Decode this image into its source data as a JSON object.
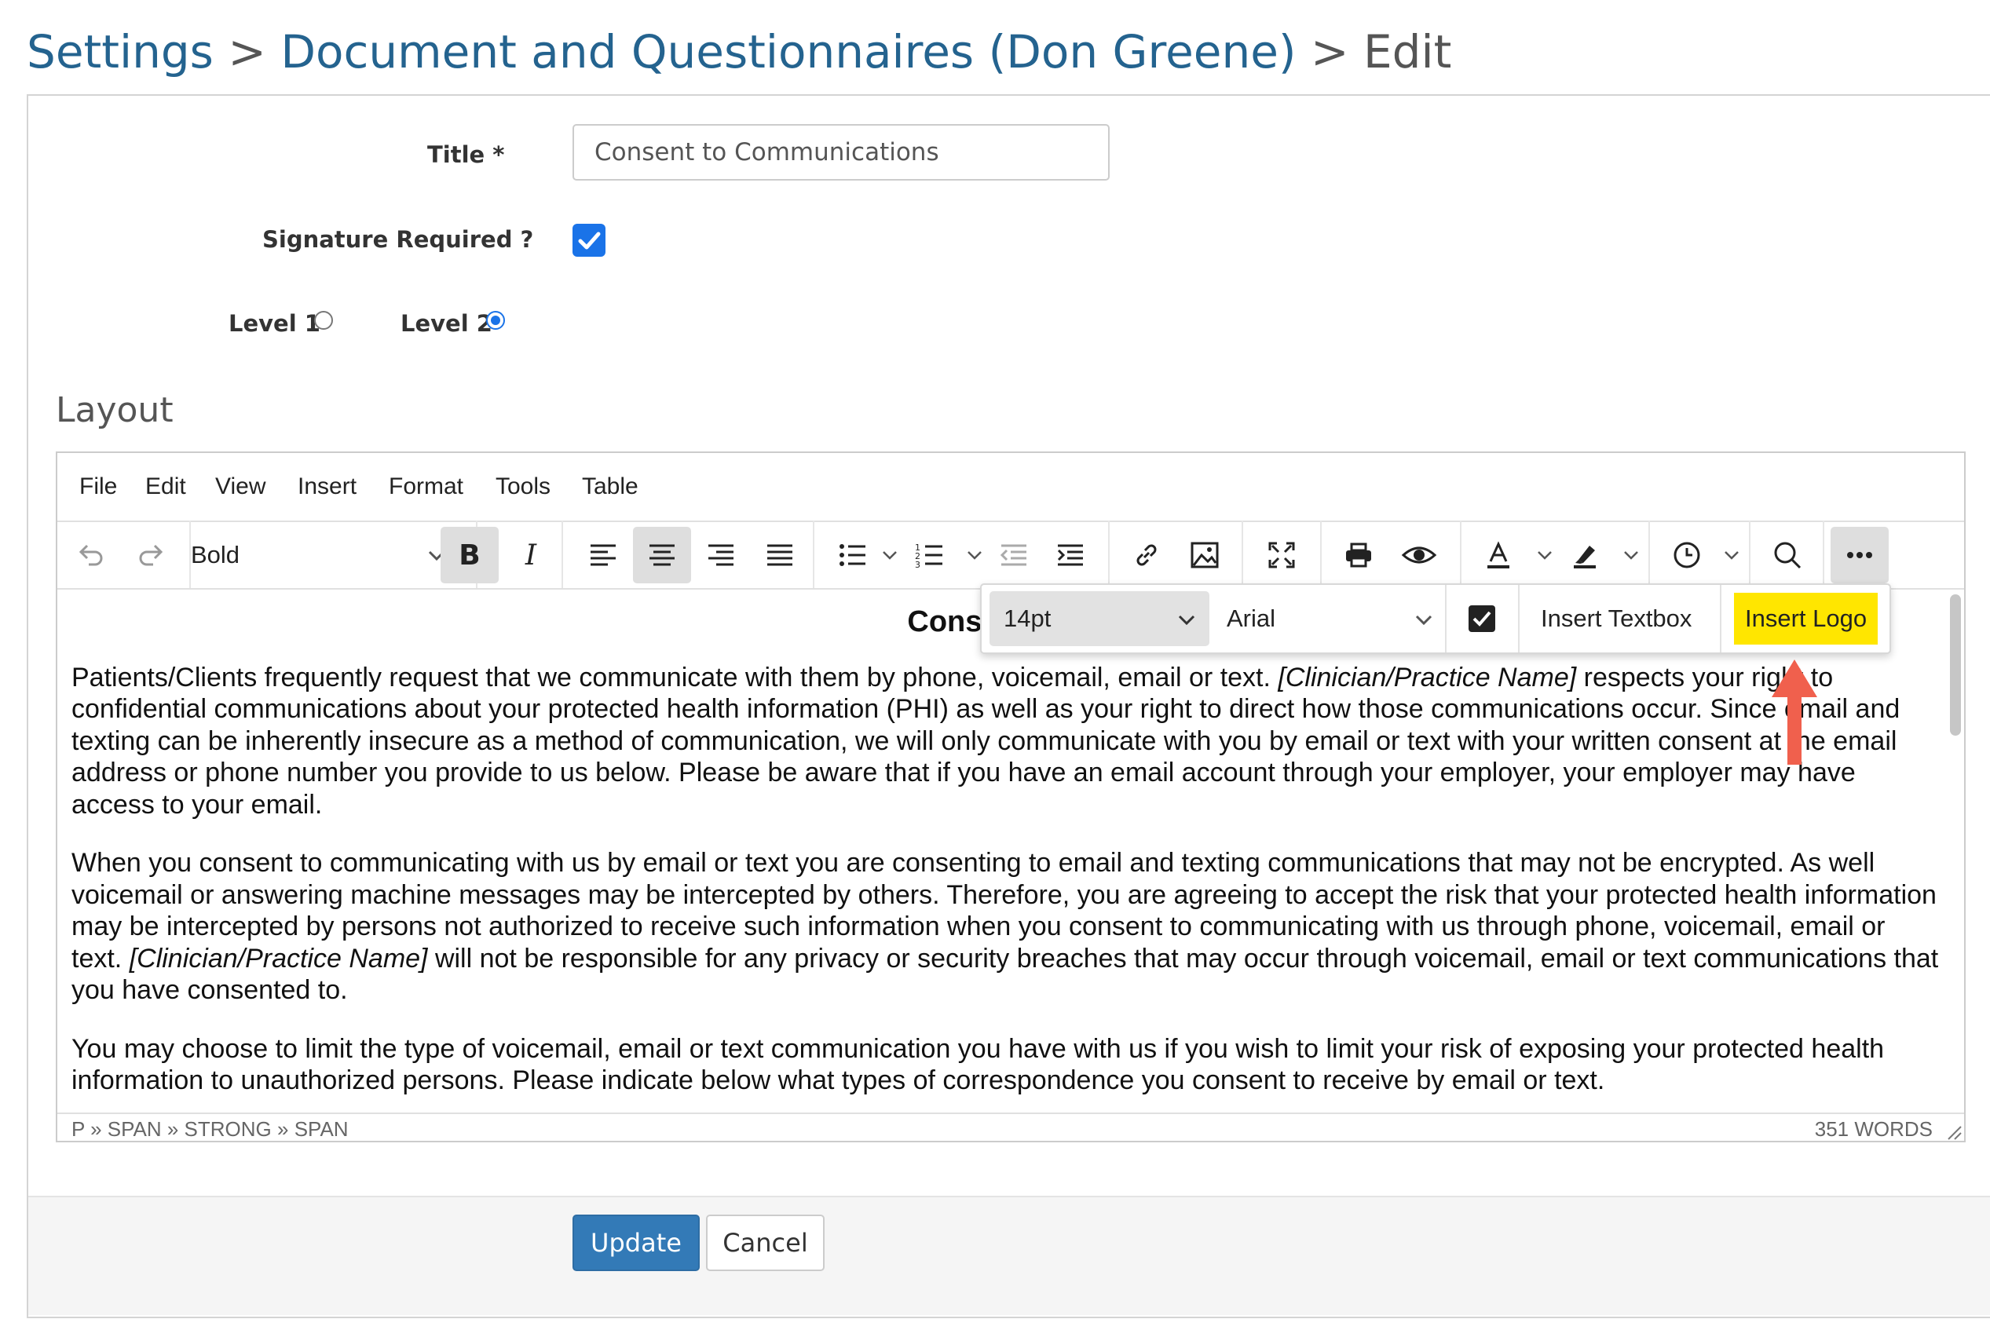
{
  "breadcrumb": {
    "items": [
      "Settings",
      "Document and Questionnaires (Don Greene)"
    ],
    "separator": ">",
    "current": "Edit"
  },
  "form": {
    "title_label": "Title *",
    "title_value": "Consent to Communications",
    "signature_label": "Signature Required ?",
    "signature_checked": true,
    "level1_label": "Level 1",
    "level2_label": "Level 2",
    "selected_level": "Level 2",
    "layout_heading": "Layout"
  },
  "editor": {
    "menu": [
      "File",
      "Edit",
      "View",
      "Insert",
      "Format",
      "Tools",
      "Table"
    ],
    "format_select": "Bold",
    "toolbar_icons": [
      "undo-icon",
      "redo-icon",
      "bold-icon",
      "italic-icon",
      "align-left-icon",
      "align-center-icon",
      "align-right-icon",
      "align-justify-icon",
      "bullet-list-icon",
      "numbered-list-icon",
      "outdent-icon",
      "indent-icon",
      "link-icon",
      "image-icon",
      "fullscreen-icon",
      "print-icon",
      "preview-icon",
      "text-color-icon",
      "highlight-icon",
      "clock-icon",
      "search-icon",
      "more-icon"
    ],
    "popup": {
      "font_size": "14pt",
      "font_family": "Arial",
      "insert_textbox": "Insert Textbox",
      "insert_logo": "Insert Logo"
    },
    "document": {
      "heading": "Consent for C",
      "p1_a": "Patients/Clients frequently request that we communicate with them by phone, voicemail, email or text. ",
      "p1_b": "[Clinician/Practice Name]",
      "p1_c": " respects your right to confidential communications about your protected health information (PHI) as well as your right to direct how those communications occur.  Since email and texting can be inherently insecure as a method of communication, we will only communicate with you by email or text with your written consent at the email address or phone number you provide to us below. Please be aware that if you have an email account through your employer, your employer may have access to your email.",
      "p2_a": "When you consent to communicating with us by email or text you are consenting to email and texting communications that may not be encrypted.  As well voicemail or answering machine messages may be intercepted by others. Therefore, you are agreeing to accept the risk that your protected health information may be intercepted by persons not authorized to receive such information when you consent to communicating with us through phone, voicemail, email or text. ",
      "p2_b": "[Clinician/Practice Name]",
      "p2_c": " will not be responsible for any privacy or security breaches that may occur through voicemail, email or text communications that you have consented to.",
      "p3": "You may choose to limit the type of voicemail, email or text communication you have with us if you wish to limit your risk of exposing your protected health information to unauthorized persons. Please indicate below what types of correspondence you consent to receive by email or text."
    },
    "status_path": "P » SPAN » STRONG » SPAN",
    "word_count": "351 WORDS"
  },
  "buttons": {
    "update": "Update",
    "cancel": "Cancel"
  },
  "colors": {
    "link": "#24638f",
    "primary": "#337ab7",
    "highlight": "#ffe600",
    "arrow": "#f0604d",
    "check": "#1a73e8"
  }
}
